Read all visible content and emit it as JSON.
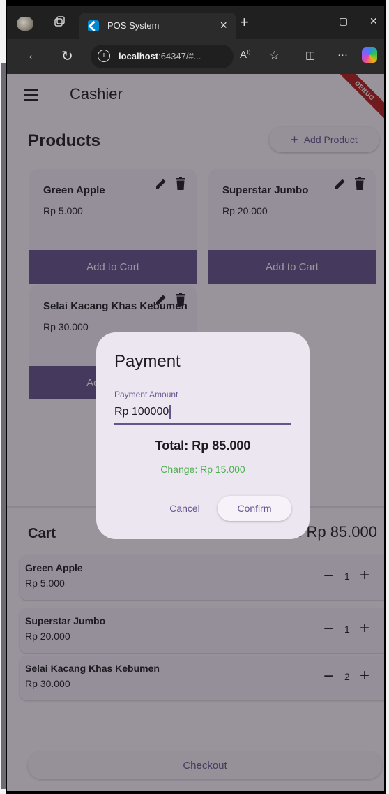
{
  "browser": {
    "tab_title": "POS System",
    "tab_close": "×",
    "new_tab": "+",
    "url_host": "localhost",
    "url_rest": ":64347/#...",
    "window_minimize": "–",
    "window_maximize": "▢",
    "window_close": "✕",
    "icons": [
      "avatar-icon",
      "tab-actions-icon",
      "flutter-icon",
      "back-icon",
      "refresh-icon",
      "info-icon",
      "read-aloud-icon",
      "favorite-icon",
      "split-screen-icon",
      "more-icon",
      "copilot-icon"
    ]
  },
  "app": {
    "title": "Cashier",
    "debug_banner": "DEBUG",
    "products_title": "Products",
    "add_product_label": "Add Product",
    "products": [
      {
        "name": "Green Apple",
        "price": "Rp 5.000",
        "action": "Add to Cart"
      },
      {
        "name": "Superstar Jumbo",
        "price": "Rp 20.000",
        "action": "Add to Cart"
      },
      {
        "name": "Selai Kacang Khas Kebumen",
        "price": "Rp 30.000",
        "action": "Add to Cart"
      }
    ],
    "cart": {
      "title": "Cart",
      "total": "Total: Rp 85.000",
      "items": [
        {
          "name": "Green Apple",
          "price": "Rp 5.000",
          "qty": "1"
        },
        {
          "name": "Superstar Jumbo",
          "price": "Rp 20.000",
          "qty": "1"
        },
        {
          "name": "Selai Kacang Khas Kebumen",
          "price": "Rp 30.000",
          "qty": "2"
        }
      ],
      "checkout_label": "Checkout"
    }
  },
  "dialog": {
    "title": "Payment",
    "field_label": "Payment Amount",
    "field_value": "Rp 100000",
    "total": "Total: Rp 85.000",
    "change": "Change: Rp 15.000",
    "cancel_label": "Cancel",
    "confirm_label": "Confirm"
  },
  "colors": {
    "primary": "#65558f",
    "surface": "#fdf7ff",
    "card": "#f4eef8",
    "change_green": "#4caf50",
    "debug_red": "#b71c1c"
  }
}
